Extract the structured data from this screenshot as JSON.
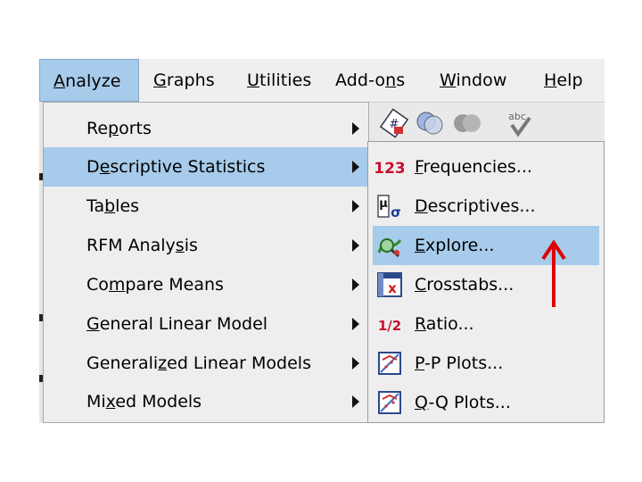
{
  "menubar": {
    "items": [
      {
        "label": "Analyze"
      },
      {
        "label": "Graphs"
      },
      {
        "label": "Utilities"
      },
      {
        "label": "Add-ons"
      },
      {
        "label": "Window"
      },
      {
        "label": "Help"
      }
    ]
  },
  "analyze_menu": {
    "items": [
      {
        "label": "Reports"
      },
      {
        "label": "Descriptive Statistics"
      },
      {
        "label": "Tables"
      },
      {
        "label": "RFM Analysis"
      },
      {
        "label": "Compare Means"
      },
      {
        "label": "General Linear Model"
      },
      {
        "label": "Generalized Linear Models"
      },
      {
        "label": "Mixed Models"
      }
    ],
    "highlighted": "Descriptive Statistics"
  },
  "descriptive_submenu": {
    "items": [
      {
        "label": "Frequencies...",
        "icon": "frequencies-123-icon",
        "icon_text": "123"
      },
      {
        "label": "Descriptives...",
        "icon": "descriptives-mu-sigma-icon"
      },
      {
        "label": "Explore...",
        "icon": "explore-magnifier-icon"
      },
      {
        "label": "Crosstabs...",
        "icon": "crosstabs-table-icon"
      },
      {
        "label": "Ratio...",
        "icon": "ratio-icon",
        "icon_text": "1/2"
      },
      {
        "label": "P-P Plots...",
        "icon": "pp-plot-icon"
      },
      {
        "label": "Q-Q Plots...",
        "icon": "qq-plot-icon"
      }
    ],
    "highlighted": "Explore..."
  },
  "colors": {
    "highlight": "#a7cbea",
    "menu_bg": "#eeeeee",
    "annotation_arrow": "#e00000"
  }
}
